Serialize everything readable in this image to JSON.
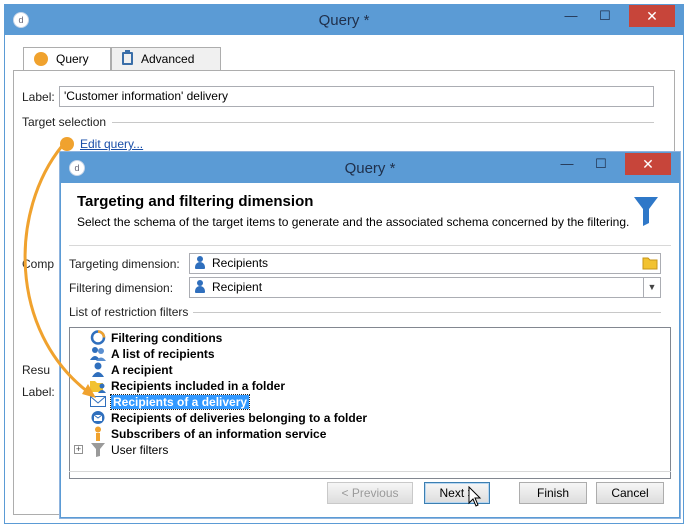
{
  "back_window": {
    "title": "Query *",
    "minimize_glyph": "—",
    "maximize_glyph": "☐",
    "close_glyph": "✕",
    "app_icon": "d",
    "tabs": [
      {
        "label": "Query",
        "icon": "orange-dot-icon",
        "active": true
      },
      {
        "label": "Advanced",
        "icon": "clipboard-icon",
        "active": false
      }
    ],
    "label_caption": "Label:",
    "label_value": "'Customer information' delivery",
    "target_selection": "Target selection",
    "edit_query_link": "Edit query...",
    "partial_label_comp": "Comp",
    "partial_label_resu": "Resu",
    "partial_label_label": "Label:"
  },
  "dialog": {
    "title": "Query *",
    "minimize_glyph": "—",
    "maximize_glyph": "☐",
    "close_glyph": "✕",
    "app_icon": "d",
    "header_title": "Targeting and filtering dimension",
    "header_subtitle": "Select the schema of the target items to  generate and the associated schema concerned by the filtering.",
    "targeting_label": "Targeting dimension:",
    "targeting_value": "Recipients",
    "filtering_label": "Filtering dimension:",
    "filtering_value": "Recipient",
    "filters_caption": "List of restriction filters",
    "filters": [
      {
        "label": "Filtering conditions",
        "icon": "filtering-conditions-icon"
      },
      {
        "label": "A list of recipients",
        "icon": "recipient-list-icon"
      },
      {
        "label": "A recipient",
        "icon": "recipient-icon"
      },
      {
        "label": "Recipients included in a folder",
        "icon": "folder-recipients-icon"
      },
      {
        "label": "Recipients of a delivery",
        "icon": "delivery-envelope-icon",
        "selected": true
      },
      {
        "label": "Recipients of deliveries belonging to a folder",
        "icon": "delivery-folder-icon"
      },
      {
        "label": "Subscribers of an information service",
        "icon": "subscriber-icon"
      },
      {
        "label": "User filters",
        "icon": "funnel-icon",
        "expander": "+"
      }
    ],
    "buttons": {
      "previous": "< Previous",
      "next": "Next >",
      "finish": "Finish",
      "cancel": "Cancel"
    },
    "colors": {
      "titlebar": "#5b9bd5",
      "accent_orange": "#f0a22e",
      "selection": "#3399ff",
      "close_button": "#c7453a"
    }
  }
}
